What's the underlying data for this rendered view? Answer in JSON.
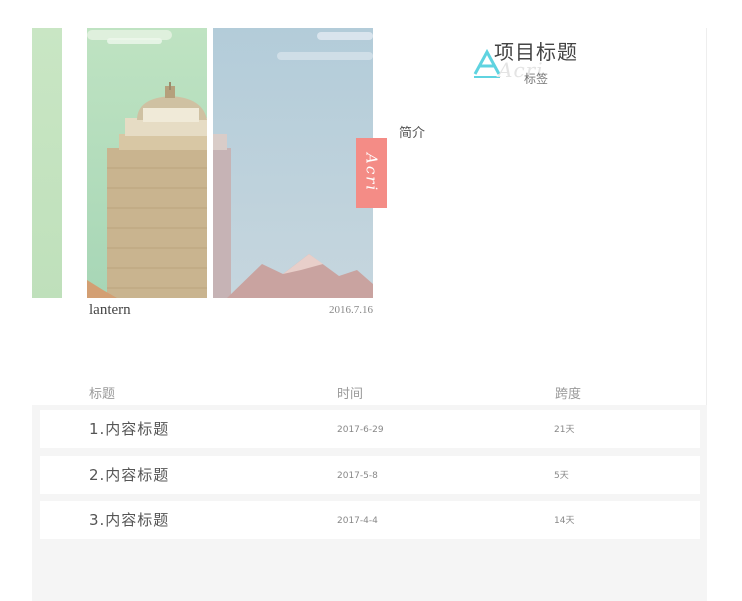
{
  "cover": {
    "ribbon_text": "Acri",
    "name": "lantern",
    "date": "2016.7.16",
    "prev_cover_color": "#c9e6c4"
  },
  "project": {
    "logo_letter": "A",
    "logo_watermark": "Acri",
    "title": "项目标题",
    "tag": "标签",
    "intro": "简介"
  },
  "table": {
    "headers": {
      "title": "标题",
      "time": "时间",
      "span": "跨度"
    },
    "rows": [
      {
        "title": "1.内容标题",
        "time": "2017-6-29",
        "span": "21天"
      },
      {
        "title": "2.内容标题",
        "time": "2017-5-8",
        "span": "5天"
      },
      {
        "title": "3.内容标题",
        "time": "2017-4-4",
        "span": "14天"
      }
    ]
  },
  "colors": {
    "ribbon": "#f48c86",
    "logo_accent": "#5fd3e0",
    "table_bg": "#f5f5f5"
  }
}
